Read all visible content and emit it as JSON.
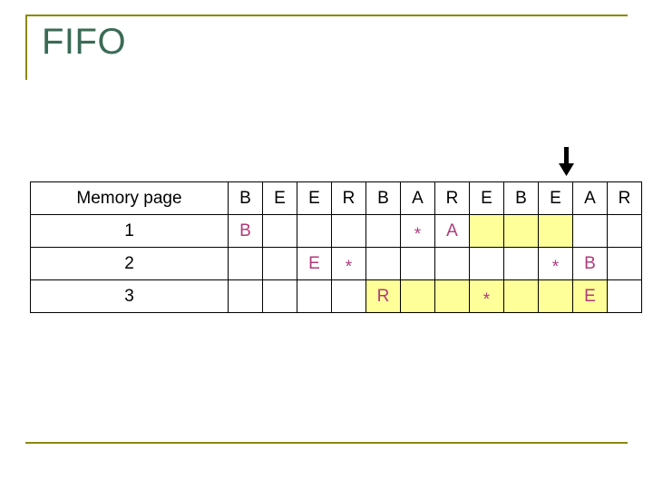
{
  "slide": {
    "title": "FIFO",
    "accent_color": "#8a8a00",
    "title_color": "#3a6b56",
    "highlight_color": "#ffff99",
    "letter_color": "#b03a7a"
  },
  "arrow": {
    "name": "down-arrow-marker"
  },
  "table": {
    "row_label_header": "Memory page",
    "reference_string": [
      "B",
      "E",
      "E",
      "R",
      "B",
      "A",
      "R",
      "E",
      "B",
      "E",
      "A",
      "R"
    ],
    "rows": [
      {
        "label": "1",
        "cells": [
          {
            "text": "B",
            "highlight": false
          },
          {
            "text": "",
            "highlight": false
          },
          {
            "text": "",
            "highlight": false
          },
          {
            "text": "",
            "highlight": false
          },
          {
            "text": "",
            "highlight": false
          },
          {
            "text": "*",
            "highlight": false
          },
          {
            "text": "A",
            "highlight": false
          },
          {
            "text": "",
            "highlight": true
          },
          {
            "text": "",
            "highlight": true
          },
          {
            "text": "",
            "highlight": true
          },
          {
            "text": "",
            "highlight": false
          },
          {
            "text": "",
            "highlight": false
          }
        ]
      },
      {
        "label": "2",
        "cells": [
          {
            "text": "",
            "highlight": false
          },
          {
            "text": "",
            "highlight": false
          },
          {
            "text": "E",
            "highlight": false
          },
          {
            "text": "*",
            "highlight": false
          },
          {
            "text": "",
            "highlight": false
          },
          {
            "text": "",
            "highlight": false
          },
          {
            "text": "",
            "highlight": false
          },
          {
            "text": "",
            "highlight": false
          },
          {
            "text": "",
            "highlight": false
          },
          {
            "text": "*",
            "highlight": false
          },
          {
            "text": "B",
            "highlight": false
          },
          {
            "text": "",
            "highlight": false
          }
        ]
      },
      {
        "label": "3",
        "cells": [
          {
            "text": "",
            "highlight": false
          },
          {
            "text": "",
            "highlight": false
          },
          {
            "text": "",
            "highlight": false
          },
          {
            "text": "",
            "highlight": false
          },
          {
            "text": "R",
            "highlight": true
          },
          {
            "text": "",
            "highlight": true
          },
          {
            "text": "",
            "highlight": true
          },
          {
            "text": "*",
            "highlight": true
          },
          {
            "text": "",
            "highlight": true
          },
          {
            "text": "",
            "highlight": true
          },
          {
            "text": "E",
            "highlight": true
          },
          {
            "text": "",
            "highlight": false
          }
        ]
      }
    ]
  }
}
